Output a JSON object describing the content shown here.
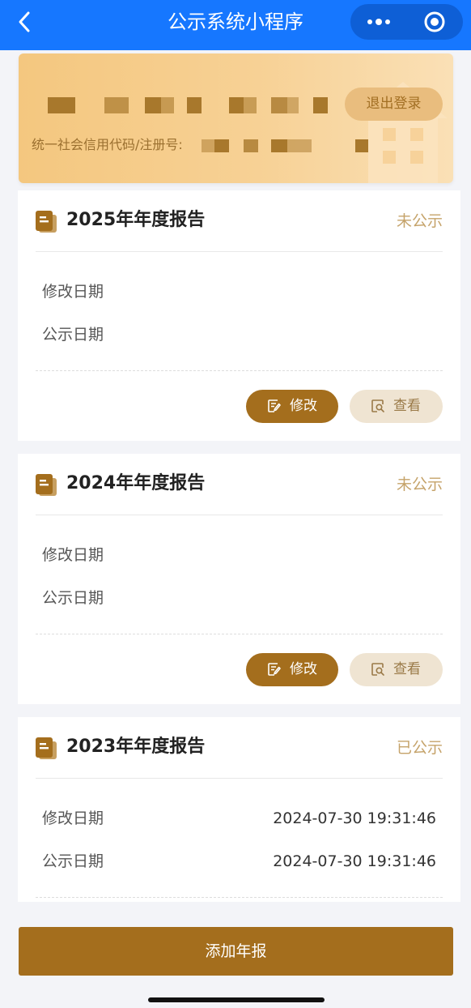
{
  "navbar": {
    "title": "公示系统小程序"
  },
  "company": {
    "logout_label": "退出登录",
    "code_label": "统一社会信用代码/注册号:"
  },
  "reports": [
    {
      "title": "2025年年度报告",
      "status": "未公示",
      "modified_label": "修改日期",
      "modified_value": "",
      "published_label": "公示日期",
      "published_value": "",
      "edit_label": "修改",
      "view_label": "查看"
    },
    {
      "title": "2024年年度报告",
      "status": "未公示",
      "modified_label": "修改日期",
      "modified_value": "",
      "published_label": "公示日期",
      "published_value": "",
      "edit_label": "修改",
      "view_label": "查看"
    },
    {
      "title": "2023年年度报告",
      "status": "已公示",
      "modified_label": "修改日期",
      "modified_value": "2024-07-30 19:31:46",
      "published_label": "公示日期",
      "published_value": "2024-07-30 19:31:46"
    }
  ],
  "footer": {
    "add_label": "添加年报"
  },
  "colors": {
    "nav": "#1677ff",
    "brand": "#a46e1d",
    "status": "#c5a36a"
  },
  "icons": [
    "back-icon",
    "more-icon",
    "close-target-icon",
    "document-icon",
    "edit-icon",
    "search-view-icon"
  ]
}
